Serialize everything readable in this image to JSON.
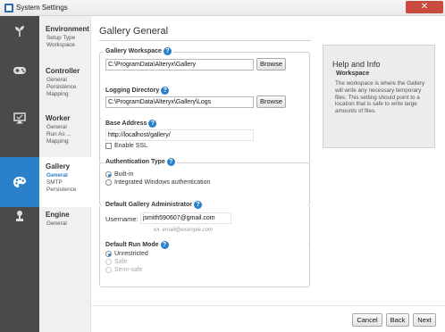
{
  "window": {
    "title": "System Settings",
    "close_glyph": "✕"
  },
  "nav": {
    "groups": [
      {
        "icon": "sprout-icon",
        "title": "Environment",
        "items": [
          "Setup Type",
          "Workspace"
        ]
      },
      {
        "icon": "gamepad-icon",
        "title": "Controller",
        "items": [
          "General",
          "Persistence",
          "Mapping"
        ]
      },
      {
        "icon": "monitor-icon",
        "title": "Worker",
        "items": [
          "General",
          "Run As ...",
          "Mapping"
        ]
      },
      {
        "icon": "palette-icon",
        "title": "Gallery",
        "items": [
          "General",
          "SMTP",
          "Persistence"
        ]
      },
      {
        "icon": "engine-icon",
        "title": "Engine",
        "items": [
          "General"
        ]
      }
    ],
    "active_group": "Gallery",
    "active_item": "General"
  },
  "page": {
    "title": "Gallery General"
  },
  "workspace": {
    "label": "Gallery Workspace",
    "value": "C:\\ProgramData\\Alteryx\\Gallery",
    "browse_label": "Browse"
  },
  "logging": {
    "label": "Logging Directory",
    "value": "C:\\ProgramData\\Alteryx\\Gallery\\Logs",
    "browse_label": "Browse"
  },
  "base_address": {
    "label": "Base Address",
    "value": "http://localhost/gallery/",
    "ssl_label": "Enable SSL",
    "ssl_checked": false
  },
  "auth": {
    "label": "Authentication Type",
    "options": [
      "Built-in",
      "Integrated Windows authentication"
    ],
    "selected": "Built-in"
  },
  "admin": {
    "label": "Default Gallery Administrator",
    "username_label": "Username:",
    "username_value": "jsmith590607@gmail.com",
    "hint": "ex. email@example.com"
  },
  "run_mode": {
    "label": "Default Run Mode",
    "options": [
      "Unrestricted",
      "Safe",
      "Semi-safe"
    ],
    "selected": "Unrestricted"
  },
  "help": {
    "title": "Help and Info",
    "subtitle": "Workspace",
    "body": "The workspace is where the Gallery will write any necessary temporary files. This setting should point to a location that is safe to write large amounts of files."
  },
  "footer": {
    "cancel": "Cancel",
    "back": "Back",
    "next": "Next"
  },
  "colors": {
    "accent": "#2a80c9",
    "iconbar": "#4a4a4a",
    "close": "#c94a3e"
  }
}
